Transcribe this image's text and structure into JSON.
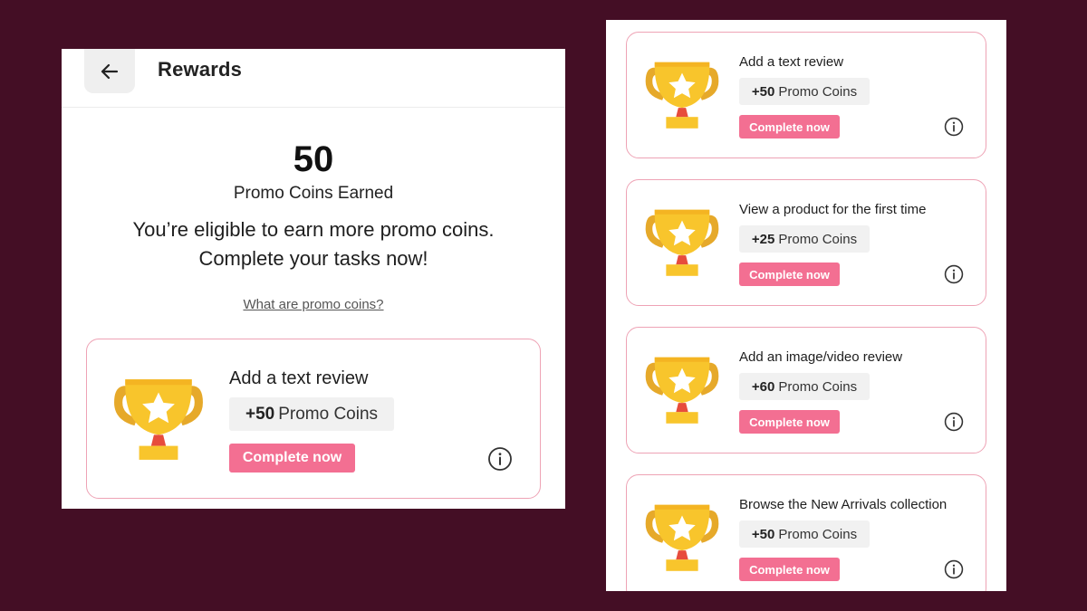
{
  "header": {
    "title": "Rewards",
    "back_icon": "arrow-left-icon"
  },
  "summary": {
    "coins": "50",
    "coins_label": "Promo Coins Earned",
    "eligible_line1": "You’re eligible to earn more promo coins.",
    "eligible_line2": "Complete your tasks now!",
    "info_link": "What are promo coins?"
  },
  "featured_task": {
    "title": "Add a text review",
    "reward_amount": "+50",
    "reward_unit": "Promo Coins",
    "button": "Complete now"
  },
  "tasks": [
    {
      "title": "Add a text review",
      "reward_amount": "+50",
      "reward_unit": "Promo Coins",
      "button": "Complete now"
    },
    {
      "title": "View a product for the first time",
      "reward_amount": "+25",
      "reward_unit": "Promo Coins",
      "button": "Complete now"
    },
    {
      "title": "Add an image/video review",
      "reward_amount": "+60",
      "reward_unit": "Promo Coins",
      "button": "Complete now"
    },
    {
      "title": "Browse the New Arrivals collection",
      "reward_amount": "+50",
      "reward_unit": "Promo Coins",
      "button": "Complete now"
    }
  ],
  "icons": {
    "trophy": "trophy-icon",
    "info": "info-icon",
    "back": "arrow-left-icon"
  },
  "colors": {
    "background": "#440e25",
    "accent_button": "#f36f92",
    "card_border": "#eea3b5",
    "trophy_gold": "#f8c52c",
    "trophy_dark_gold": "#e6a92a",
    "trophy_stem": "#e74c3c"
  }
}
